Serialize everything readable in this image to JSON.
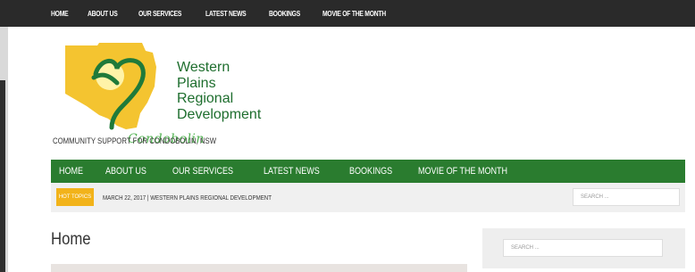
{
  "topnav": [
    "HOME",
    "ABOUT US",
    "OUR SERVICES",
    "LATEST NEWS",
    "BOOKINGS",
    "MOVIE OF THE MONTH"
  ],
  "logo": {
    "line1": "Western",
    "line2": "Plains",
    "line3": "Regional",
    "line4": "Development",
    "script": "Condobolin"
  },
  "tagline": "COMMUNITY SUPPORT FOR CONDOBOLIN, NSW",
  "mainnav": [
    "HOME",
    "ABOUT US",
    "OUR SERVICES",
    "LATEST NEWS",
    "BOOKINGS",
    "MOVIE OF THE MONTH"
  ],
  "hot_topics": {
    "badge": "HOT TOPICS",
    "text": "MARCH 22, 2017  |  WESTERN PLAINS REGIONAL DEVELOPMENT",
    "search_placeholder": "SEARCH ..."
  },
  "page_title": "Home",
  "sidebar": {
    "search_placeholder": "SEARCH ..."
  },
  "colors": {
    "nav_green": "#2a7c2f",
    "hot_yellow": "#f2b31a",
    "topbar": "#2a2a2a"
  }
}
